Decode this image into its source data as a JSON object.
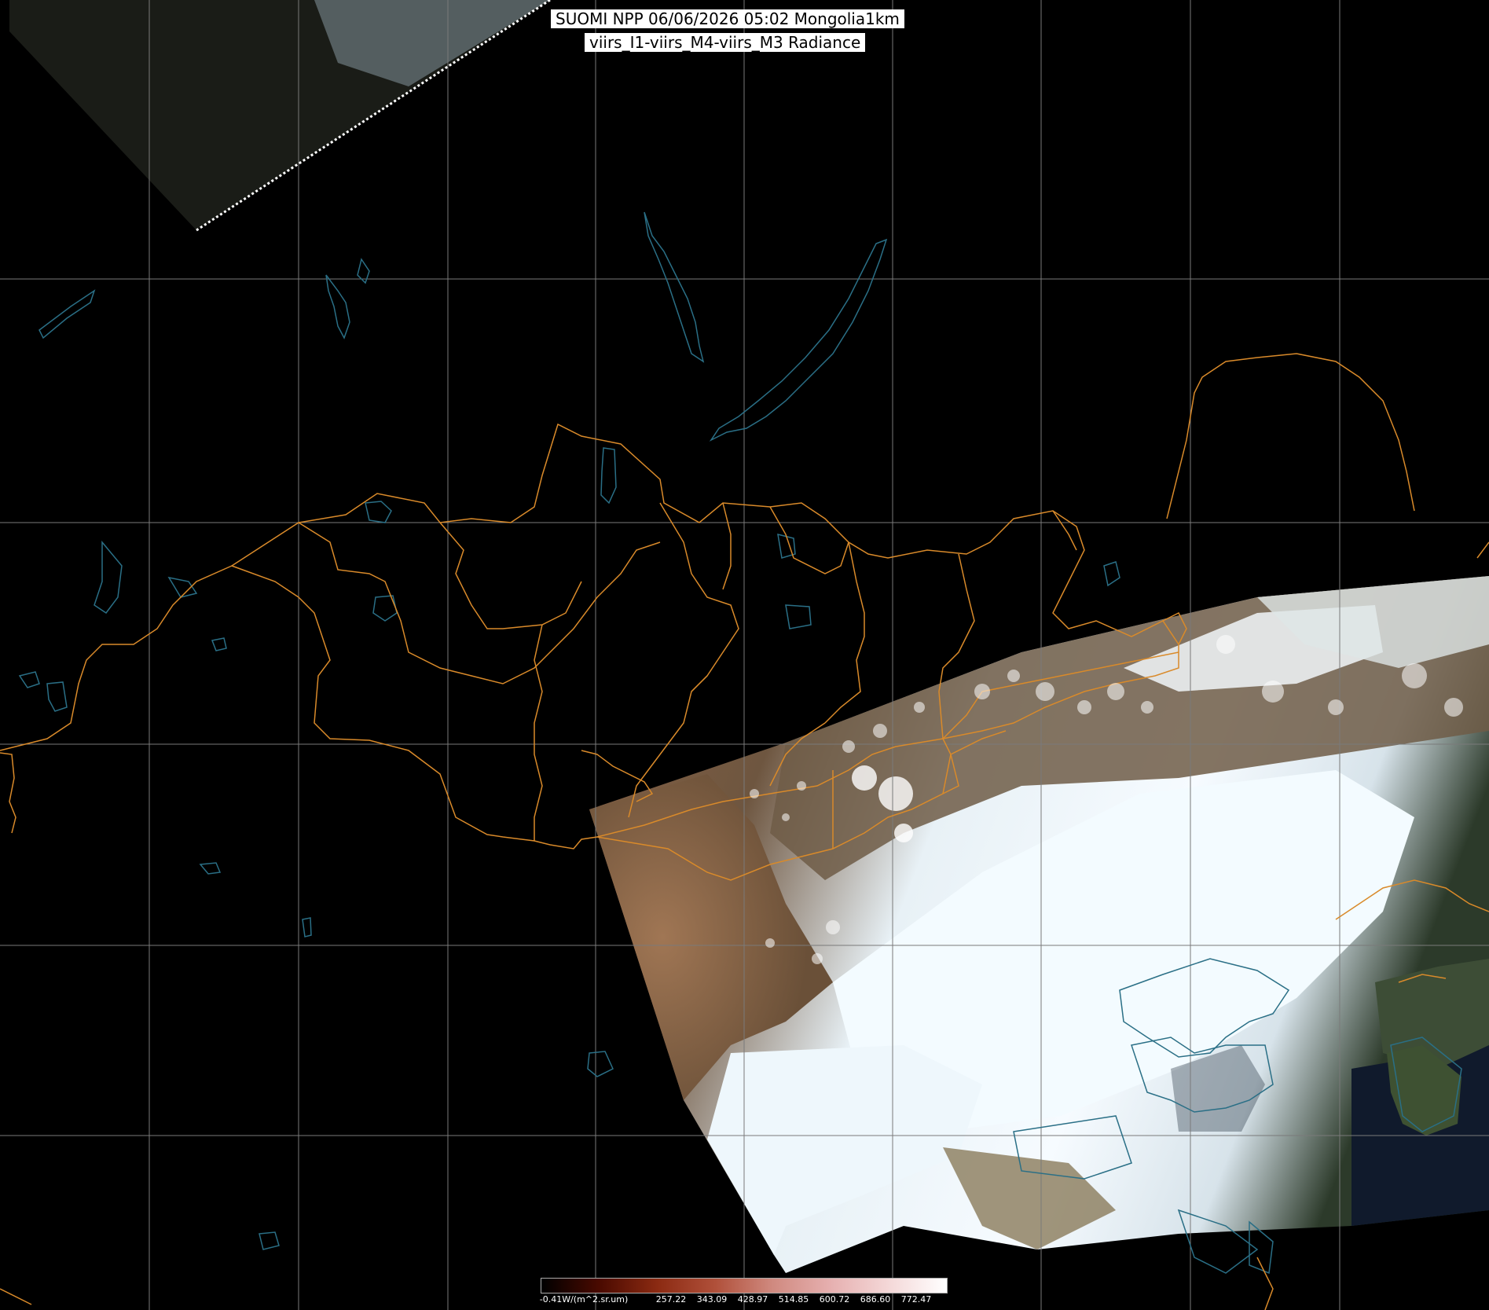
{
  "title": {
    "line1": "SUOMI NPP 06/06/2026 05:02 Mongolia1km",
    "line2": "viirs_I1-viirs_M4-viirs_M3 Radiance"
  },
  "colorbar": {
    "labels": [
      "-0.41W/(m^2.sr.um)",
      "257.22",
      "343.09",
      "428.97",
      "514.85",
      "600.72",
      "686.60",
      "772.47"
    ],
    "colors": [
      "#000000",
      "#4a0a00",
      "#8b2a12",
      "#b0503a",
      "#d08a80",
      "#e6b0b0",
      "#f4d8d8",
      "#ffffff"
    ]
  },
  "colors": {
    "grid": "#7a7a7a",
    "borders": "#d98a2a",
    "water": "#2a6f86",
    "cloud": "#f4fbff",
    "land_desert": "#8a6a4a",
    "land_green": "#3b4a2e"
  }
}
